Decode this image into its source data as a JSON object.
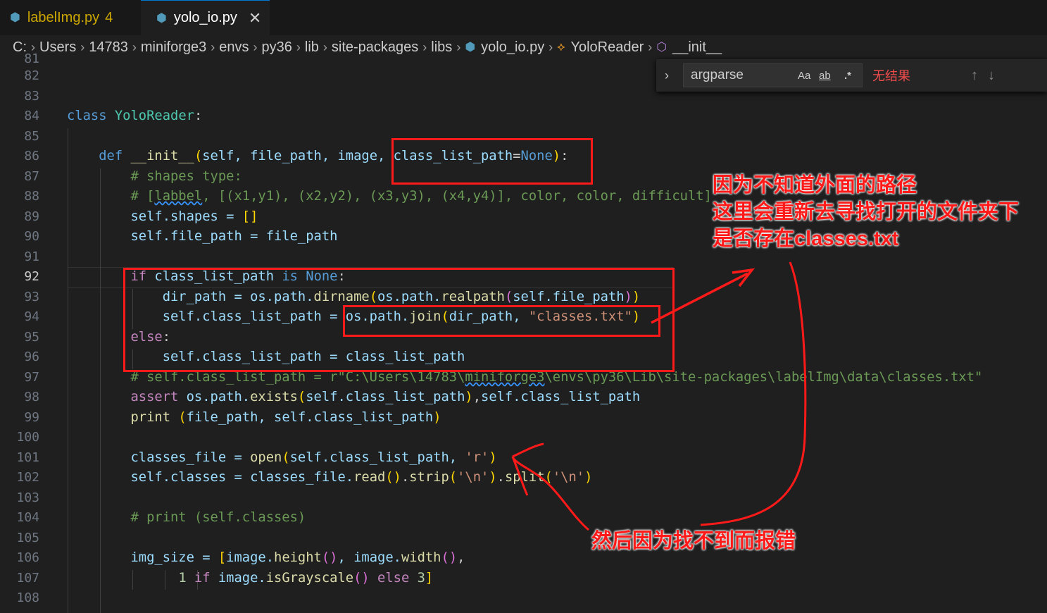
{
  "tabs": [
    {
      "label": "labelImg.py",
      "badge": "4",
      "icon": "python-icon",
      "color": "#cca700"
    },
    {
      "label": "yolo_io.py",
      "close": "✕",
      "icon": "python-icon",
      "active": true
    }
  ],
  "breadcrumb": [
    "C:",
    "Users",
    "14783",
    "miniforge3",
    "envs",
    "py36",
    "lib",
    "site-packages",
    "libs",
    "yolo_io.py",
    "YoloReader",
    "__init__"
  ],
  "find": {
    "query": "argparse",
    "match_case": "Aa",
    "whole_word": "ab",
    "regex": ".*",
    "result": "无结果",
    "prev": "↑",
    "next": "↓"
  },
  "line_numbers": [
    "81",
    "82",
    "83",
    "84",
    "85",
    "86",
    "87",
    "88",
    "89",
    "90",
    "91",
    "92",
    "93",
    "94",
    "95",
    "96",
    "97",
    "98",
    "99",
    "100",
    "101",
    "102",
    "103",
    "104",
    "105",
    "106",
    "107",
    "108"
  ],
  "code": {
    "l84": [
      "class",
      "YoloReader",
      ":"
    ],
    "l86": [
      "def",
      "__init__",
      "(",
      "self, file_path, image, class_list_path",
      "=",
      "None",
      ")",
      ":"
    ],
    "l87": "# shapes type:",
    "l88a": "# [",
    "l88b": "labbel",
    "l88c": ", [(x1,y1), (x2,y2), (x3,y3), (x4,y4)], color, color, difficult]",
    "l89": [
      "self",
      ".shapes = ",
      "[]"
    ],
    "l90": [
      "self",
      ".file_path = file_path"
    ],
    "l92": [
      "if",
      "class_list_path",
      "is",
      "None",
      ":"
    ],
    "l93": [
      "dir_path = os.path.",
      "dirname",
      "(",
      "os.path.",
      "realpath",
      "(",
      "self",
      ".file_path",
      ")",
      ")"
    ],
    "l94": [
      "self",
      ".class_list_path = os.path.",
      "join",
      "(",
      "dir_path, ",
      "\"classes.txt\"",
      ")"
    ],
    "l95": [
      "else",
      ":"
    ],
    "l96": [
      "self",
      ".class_list_path = class_list_path"
    ],
    "l97a": "# self.class_list_path = r\"C:\\Users\\14783\\",
    "l97b": "miniforge3",
    "l97c": "\\envs\\py36\\Lib\\site-packages\\labelImg\\data\\classes.txt\"",
    "l98": [
      "assert",
      " os.path.",
      "exists",
      "(",
      "self",
      ".class_list_path",
      ")",
      ",",
      "self",
      ".class_list_path"
    ],
    "l99": [
      "print",
      " (",
      "file_path, ",
      "self",
      ".class_list_path",
      ")"
    ],
    "l101": [
      "classes_file = ",
      "open",
      "(",
      "self",
      ".class_list_path, ",
      "'r'",
      ")"
    ],
    "l102": [
      "self",
      ".classes = classes_file.",
      "read",
      "(",
      ")",
      ".",
      "strip",
      "(",
      "'\\n'",
      ")",
      ".",
      "split",
      "(",
      "'\\n'",
      ")"
    ],
    "l104": "# print (self.classes)",
    "l106": [
      "img_size = ",
      "[",
      "image.",
      "height",
      "(",
      ")",
      ", image.",
      "width",
      "(",
      ")",
      ","
    ],
    "l107": [
      "1",
      "if",
      " image.",
      "isGrayscale",
      "(",
      ")",
      "else",
      "3",
      "]"
    ]
  },
  "annotations": {
    "note1": [
      "因为不知道外面的路径",
      "这里会重新去寻找打开的文件夹下",
      "是否存在classes.txt"
    ],
    "note2": "然后因为找不到而报错"
  },
  "colors": {
    "annotation": "#ff1a1a",
    "editor_bg": "#1f1f1f",
    "keyword": "#569cd6",
    "control": "#c586c0",
    "class": "#4ec9b0",
    "function": "#dcdcaa",
    "string": "#ce9178",
    "comment": "#6a9955"
  }
}
